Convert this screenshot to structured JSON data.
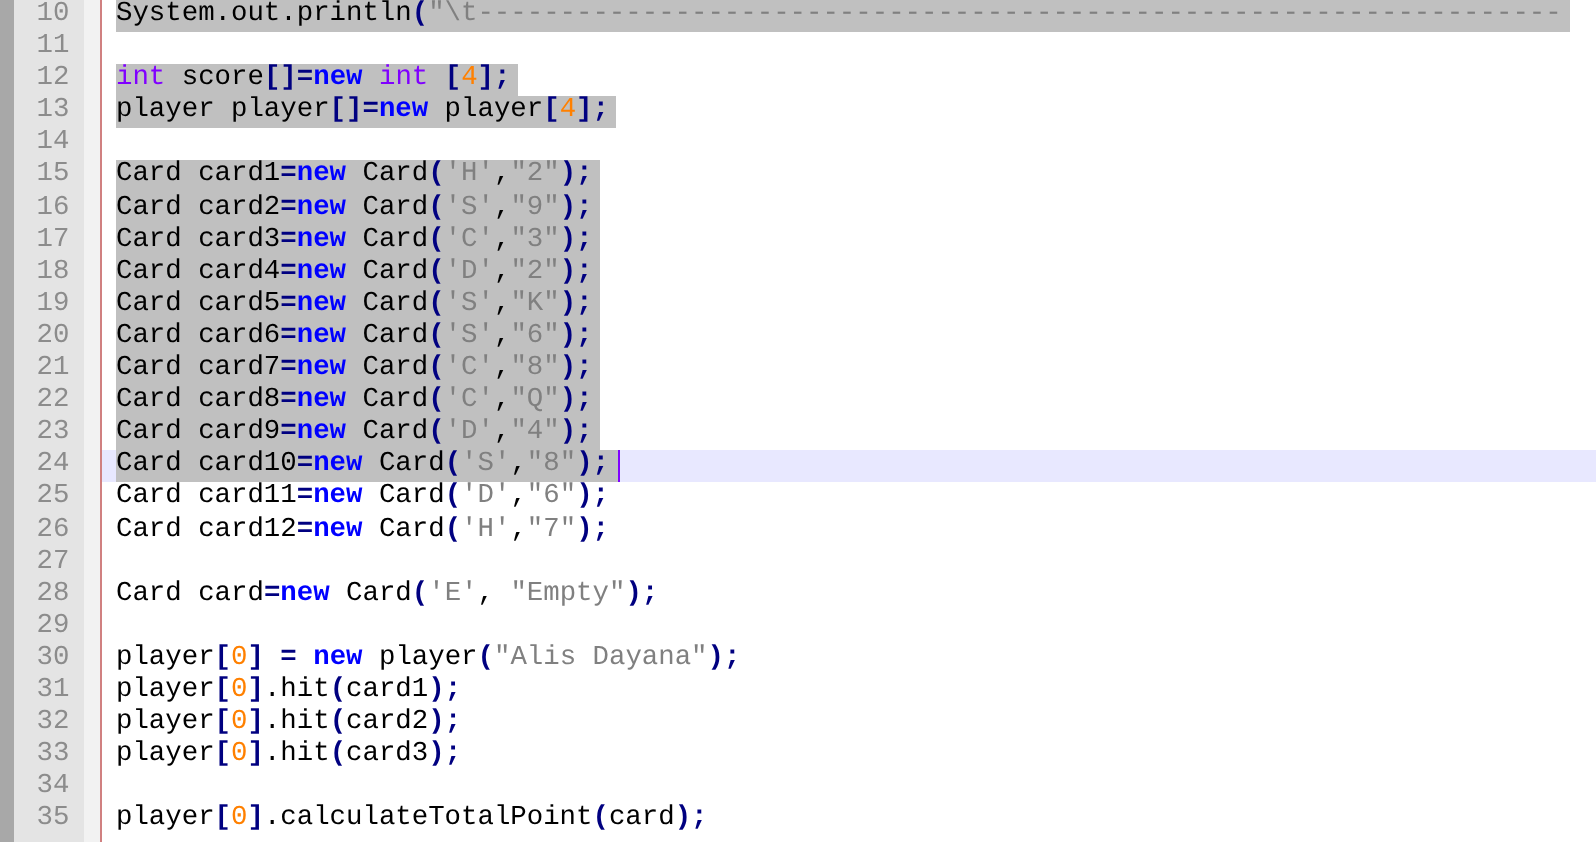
{
  "editor": {
    "lines": [
      {
        "number": "10",
        "selected": true,
        "current": false,
        "tokens": [
          {
            "kind": "plain",
            "text": "System.out.println"
          },
          {
            "kind": "op",
            "text": "("
          },
          {
            "kind": "string",
            "text": "\"\\t------------------------------------------------------------------"
          }
        ]
      },
      {
        "number": "11",
        "selected": false,
        "current": false
      },
      {
        "number": "12",
        "selected": true,
        "current": false,
        "tokens": [
          {
            "kind": "type",
            "text": "int"
          },
          {
            "kind": "plain",
            "text": " score"
          },
          {
            "kind": "op",
            "text": "[]="
          },
          {
            "kind": "keyword",
            "text": "new"
          },
          {
            "kind": "type",
            "text": " int"
          },
          {
            "kind": "op",
            "text": " ["
          },
          {
            "kind": "number",
            "text": "4"
          },
          {
            "kind": "op",
            "text": "];"
          }
        ]
      },
      {
        "number": "13",
        "selected": true,
        "current": false,
        "tokens": [
          {
            "kind": "plain",
            "text": "player player"
          },
          {
            "kind": "op",
            "text": "[]="
          },
          {
            "kind": "keyword",
            "text": "new"
          },
          {
            "kind": "plain",
            "text": " player"
          },
          {
            "kind": "op",
            "text": "["
          },
          {
            "kind": "number",
            "text": "4"
          },
          {
            "kind": "op",
            "text": "];"
          }
        ]
      },
      {
        "number": "14",
        "selected": false,
        "current": false
      },
      {
        "number": "15",
        "selected": true,
        "current": false,
        "tokens": [
          {
            "kind": "plain",
            "text": "Card card1"
          },
          {
            "kind": "op",
            "text": "="
          },
          {
            "kind": "keyword",
            "text": "new"
          },
          {
            "kind": "plain",
            "text": " Card"
          },
          {
            "kind": "op",
            "text": "("
          },
          {
            "kind": "string",
            "text": "'H'"
          },
          {
            "kind": "plain",
            "text": ","
          },
          {
            "kind": "string",
            "text": "\"2\""
          },
          {
            "kind": "op",
            "text": ");"
          }
        ]
      },
      {
        "number": "16",
        "selected": true,
        "current": false,
        "tokens": [
          {
            "kind": "plain",
            "text": "Card card2"
          },
          {
            "kind": "op",
            "text": "="
          },
          {
            "kind": "keyword",
            "text": "new"
          },
          {
            "kind": "plain",
            "text": " Card"
          },
          {
            "kind": "op",
            "text": "("
          },
          {
            "kind": "string",
            "text": "'S'"
          },
          {
            "kind": "plain",
            "text": ","
          },
          {
            "kind": "string",
            "text": "\"9\""
          },
          {
            "kind": "op",
            "text": ");"
          }
        ]
      },
      {
        "number": "17",
        "selected": true,
        "current": false,
        "tokens": [
          {
            "kind": "plain",
            "text": "Card card3"
          },
          {
            "kind": "op",
            "text": "="
          },
          {
            "kind": "keyword",
            "text": "new"
          },
          {
            "kind": "plain",
            "text": " Card"
          },
          {
            "kind": "op",
            "text": "("
          },
          {
            "kind": "string",
            "text": "'C'"
          },
          {
            "kind": "plain",
            "text": ","
          },
          {
            "kind": "string",
            "text": "\"3\""
          },
          {
            "kind": "op",
            "text": ");"
          }
        ]
      },
      {
        "number": "18",
        "selected": true,
        "current": false,
        "tokens": [
          {
            "kind": "plain",
            "text": "Card card4"
          },
          {
            "kind": "op",
            "text": "="
          },
          {
            "kind": "keyword",
            "text": "new"
          },
          {
            "kind": "plain",
            "text": " Card"
          },
          {
            "kind": "op",
            "text": "("
          },
          {
            "kind": "string",
            "text": "'D'"
          },
          {
            "kind": "plain",
            "text": ","
          },
          {
            "kind": "string",
            "text": "\"2\""
          },
          {
            "kind": "op",
            "text": ");"
          }
        ]
      },
      {
        "number": "19",
        "selected": true,
        "current": false,
        "tokens": [
          {
            "kind": "plain",
            "text": "Card card5"
          },
          {
            "kind": "op",
            "text": "="
          },
          {
            "kind": "keyword",
            "text": "new"
          },
          {
            "kind": "plain",
            "text": " Card"
          },
          {
            "kind": "op",
            "text": "("
          },
          {
            "kind": "string",
            "text": "'S'"
          },
          {
            "kind": "plain",
            "text": ","
          },
          {
            "kind": "string",
            "text": "\"K\""
          },
          {
            "kind": "op",
            "text": ");"
          }
        ]
      },
      {
        "number": "20",
        "selected": true,
        "current": false,
        "tokens": [
          {
            "kind": "plain",
            "text": "Card card6"
          },
          {
            "kind": "op",
            "text": "="
          },
          {
            "kind": "keyword",
            "text": "new"
          },
          {
            "kind": "plain",
            "text": " Card"
          },
          {
            "kind": "op",
            "text": "("
          },
          {
            "kind": "string",
            "text": "'S'"
          },
          {
            "kind": "plain",
            "text": ","
          },
          {
            "kind": "string",
            "text": "\"6\""
          },
          {
            "kind": "op",
            "text": ");"
          }
        ]
      },
      {
        "number": "21",
        "selected": true,
        "current": false,
        "tokens": [
          {
            "kind": "plain",
            "text": "Card card7"
          },
          {
            "kind": "op",
            "text": "="
          },
          {
            "kind": "keyword",
            "text": "new"
          },
          {
            "kind": "plain",
            "text": " Card"
          },
          {
            "kind": "op",
            "text": "("
          },
          {
            "kind": "string",
            "text": "'C'"
          },
          {
            "kind": "plain",
            "text": ","
          },
          {
            "kind": "string",
            "text": "\"8\""
          },
          {
            "kind": "op",
            "text": ");"
          }
        ]
      },
      {
        "number": "22",
        "selected": true,
        "current": false,
        "tokens": [
          {
            "kind": "plain",
            "text": "Card card8"
          },
          {
            "kind": "op",
            "text": "="
          },
          {
            "kind": "keyword",
            "text": "new"
          },
          {
            "kind": "plain",
            "text": " Card"
          },
          {
            "kind": "op",
            "text": "("
          },
          {
            "kind": "string",
            "text": "'C'"
          },
          {
            "kind": "plain",
            "text": ","
          },
          {
            "kind": "string",
            "text": "\"Q\""
          },
          {
            "kind": "op",
            "text": ");"
          }
        ]
      },
      {
        "number": "23",
        "selected": true,
        "current": false,
        "tokens": [
          {
            "kind": "plain",
            "text": "Card card9"
          },
          {
            "kind": "op",
            "text": "="
          },
          {
            "kind": "keyword",
            "text": "new"
          },
          {
            "kind": "plain",
            "text": " Card"
          },
          {
            "kind": "op",
            "text": "("
          },
          {
            "kind": "string",
            "text": "'D'"
          },
          {
            "kind": "plain",
            "text": ","
          },
          {
            "kind": "string",
            "text": "\"4\""
          },
          {
            "kind": "op",
            "text": ");"
          }
        ]
      },
      {
        "number": "24",
        "selected": true,
        "current": true,
        "tokens": [
          {
            "kind": "plain",
            "text": "Card card10"
          },
          {
            "kind": "op",
            "text": "="
          },
          {
            "kind": "keyword",
            "text": "new"
          },
          {
            "kind": "plain",
            "text": " Card"
          },
          {
            "kind": "op",
            "text": "("
          },
          {
            "kind": "string",
            "text": "'S'"
          },
          {
            "kind": "plain",
            "text": ","
          },
          {
            "kind": "string",
            "text": "\"8\""
          },
          {
            "kind": "op",
            "text": ");"
          }
        ]
      },
      {
        "number": "25",
        "selected": false,
        "current": false,
        "tokens": [
          {
            "kind": "plain",
            "text": "Card card11"
          },
          {
            "kind": "op",
            "text": "="
          },
          {
            "kind": "keyword",
            "text": "new"
          },
          {
            "kind": "plain",
            "text": " Card"
          },
          {
            "kind": "op",
            "text": "("
          },
          {
            "kind": "string",
            "text": "'D'"
          },
          {
            "kind": "plain",
            "text": ","
          },
          {
            "kind": "string",
            "text": "\"6\""
          },
          {
            "kind": "op",
            "text": ");"
          }
        ]
      },
      {
        "number": "26",
        "selected": false,
        "current": false,
        "tokens": [
          {
            "kind": "plain",
            "text": "Card card12"
          },
          {
            "kind": "op",
            "text": "="
          },
          {
            "kind": "keyword",
            "text": "new"
          },
          {
            "kind": "plain",
            "text": " Card"
          },
          {
            "kind": "op",
            "text": "("
          },
          {
            "kind": "string",
            "text": "'H'"
          },
          {
            "kind": "plain",
            "text": ","
          },
          {
            "kind": "string",
            "text": "\"7\""
          },
          {
            "kind": "op",
            "text": ");"
          }
        ]
      },
      {
        "number": "27",
        "selected": false,
        "current": false
      },
      {
        "number": "28",
        "selected": false,
        "current": false,
        "tokens": [
          {
            "kind": "plain",
            "text": "Card card"
          },
          {
            "kind": "op",
            "text": "="
          },
          {
            "kind": "keyword",
            "text": "new"
          },
          {
            "kind": "plain",
            "text": " Card"
          },
          {
            "kind": "op",
            "text": "("
          },
          {
            "kind": "string",
            "text": "'E'"
          },
          {
            "kind": "plain",
            "text": ", "
          },
          {
            "kind": "string",
            "text": "\"Empty\""
          },
          {
            "kind": "op",
            "text": ");"
          }
        ]
      },
      {
        "number": "29",
        "selected": false,
        "current": false
      },
      {
        "number": "30",
        "selected": false,
        "current": false,
        "tokens": [
          {
            "kind": "plain",
            "text": "player"
          },
          {
            "kind": "op",
            "text": "["
          },
          {
            "kind": "number",
            "text": "0"
          },
          {
            "kind": "op",
            "text": "]"
          },
          {
            "kind": "op",
            "text": " = "
          },
          {
            "kind": "keyword",
            "text": "new"
          },
          {
            "kind": "plain",
            "text": " player"
          },
          {
            "kind": "op",
            "text": "("
          },
          {
            "kind": "string",
            "text": "\"Alis Dayana\""
          },
          {
            "kind": "op",
            "text": ");"
          }
        ]
      },
      {
        "number": "31",
        "selected": false,
        "current": false,
        "tokens": [
          {
            "kind": "plain",
            "text": "player"
          },
          {
            "kind": "op",
            "text": "["
          },
          {
            "kind": "number",
            "text": "0"
          },
          {
            "kind": "op",
            "text": "]"
          },
          {
            "kind": "plain",
            "text": ".hit"
          },
          {
            "kind": "op",
            "text": "("
          },
          {
            "kind": "plain",
            "text": "card1"
          },
          {
            "kind": "op",
            "text": ");"
          }
        ]
      },
      {
        "number": "32",
        "selected": false,
        "current": false,
        "tokens": [
          {
            "kind": "plain",
            "text": "player"
          },
          {
            "kind": "op",
            "text": "["
          },
          {
            "kind": "number",
            "text": "0"
          },
          {
            "kind": "op",
            "text": "]"
          },
          {
            "kind": "plain",
            "text": ".hit"
          },
          {
            "kind": "op",
            "text": "("
          },
          {
            "kind": "plain",
            "text": "card2"
          },
          {
            "kind": "op",
            "text": ");"
          }
        ]
      },
      {
        "number": "33",
        "selected": false,
        "current": false,
        "tokens": [
          {
            "kind": "plain",
            "text": "player"
          },
          {
            "kind": "op",
            "text": "["
          },
          {
            "kind": "number",
            "text": "0"
          },
          {
            "kind": "op",
            "text": "]"
          },
          {
            "kind": "plain",
            "text": ".hit"
          },
          {
            "kind": "op",
            "text": "("
          },
          {
            "kind": "plain",
            "text": "card3"
          },
          {
            "kind": "op",
            "text": ");"
          }
        ]
      },
      {
        "number": "34",
        "selected": false,
        "current": false
      },
      {
        "number": "35",
        "selected": false,
        "current": false,
        "tokens": [
          {
            "kind": "plain",
            "text": "player"
          },
          {
            "kind": "op",
            "text": "["
          },
          {
            "kind": "number",
            "text": "0"
          },
          {
            "kind": "op",
            "text": "]"
          },
          {
            "kind": "plain",
            "text": ".calculateTotalPoint"
          },
          {
            "kind": "op",
            "text": "("
          },
          {
            "kind": "plain",
            "text": "card"
          },
          {
            "kind": "op",
            "text": ");"
          }
        ]
      }
    ]
  }
}
